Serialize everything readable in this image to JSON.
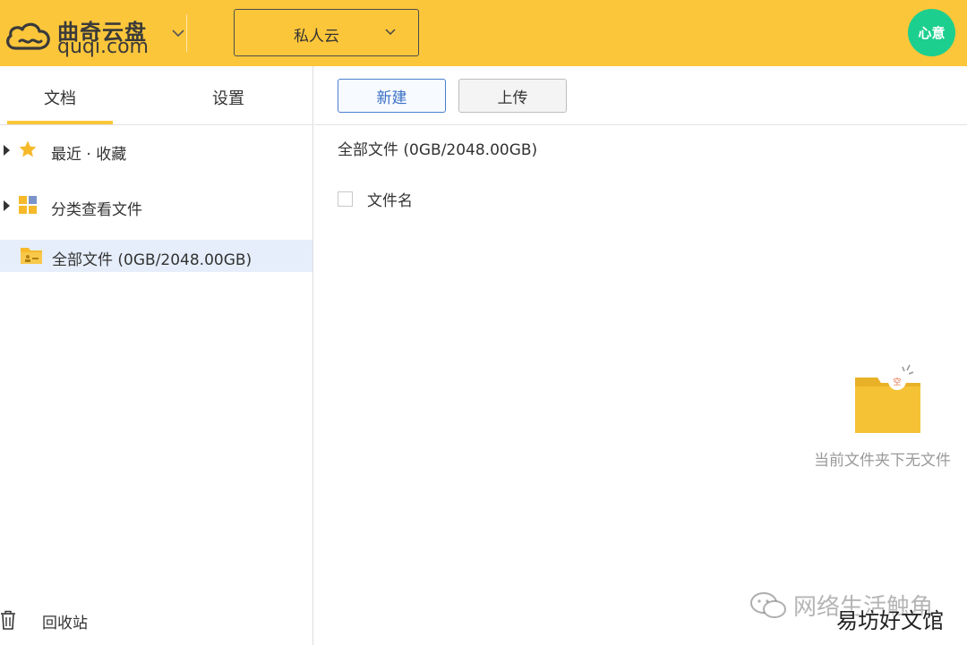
{
  "header": {
    "logo_cn": "曲奇云盘",
    "logo_en": "quqi.com",
    "space_selector": "私人云",
    "avatar_text": "心意",
    "accent_color": "#fcc63b",
    "avatar_color": "#1dcf8f"
  },
  "sidebar": {
    "tabs": [
      {
        "label": "文档",
        "active": true
      },
      {
        "label": "设置",
        "active": false
      }
    ],
    "items": [
      {
        "label": "最近 · 收藏",
        "icon": "star-icon"
      },
      {
        "label": "分类查看文件",
        "icon": "category-icon"
      },
      {
        "label": "全部文件 (0GB/2048.00GB)",
        "icon": "folder-icon",
        "active": true
      }
    ],
    "trash_label": "回收站"
  },
  "toolbar": {
    "new_label": "新建",
    "upload_label": "上传"
  },
  "main": {
    "breadcrumb": "全部文件 (0GB/2048.00GB)",
    "column_filename": "文件名",
    "empty_badge": "空",
    "empty_message": "当前文件夹下无文件"
  },
  "watermark": {
    "line1": "网络生活触角",
    "line2": "易坊好文馆"
  }
}
